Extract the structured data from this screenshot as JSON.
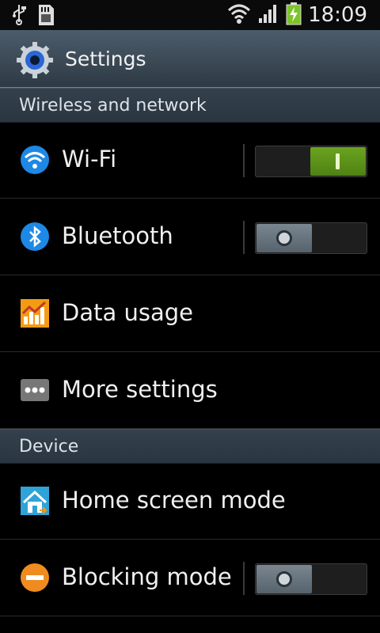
{
  "status_bar": {
    "time": "18:09",
    "icons": [
      "usb-icon",
      "sd-card-icon",
      "wifi-signal-icon",
      "cell-signal-icon",
      "battery-charging-icon"
    ]
  },
  "header": {
    "title": "Settings",
    "icon": "gear-icon"
  },
  "sections": {
    "wireless": {
      "title": "Wireless and network",
      "items": [
        {
          "label": "Wi-Fi",
          "icon": "wifi-icon",
          "toggle": "on"
        },
        {
          "label": "Bluetooth",
          "icon": "bluetooth-icon",
          "toggle": "off"
        },
        {
          "label": "Data usage",
          "icon": "data-usage-icon"
        },
        {
          "label": "More settings",
          "icon": "more-icon"
        }
      ]
    },
    "device": {
      "title": "Device",
      "items": [
        {
          "label": "Home screen mode",
          "icon": "home-icon"
        },
        {
          "label": "Blocking mode",
          "icon": "blocking-icon",
          "toggle": "off"
        }
      ]
    }
  },
  "colors": {
    "toggle_on": "#5e961a",
    "toggle_off": "#6b7781",
    "header_gradient_top": "#4c5c6a",
    "section_bg": "#2f3b46"
  }
}
